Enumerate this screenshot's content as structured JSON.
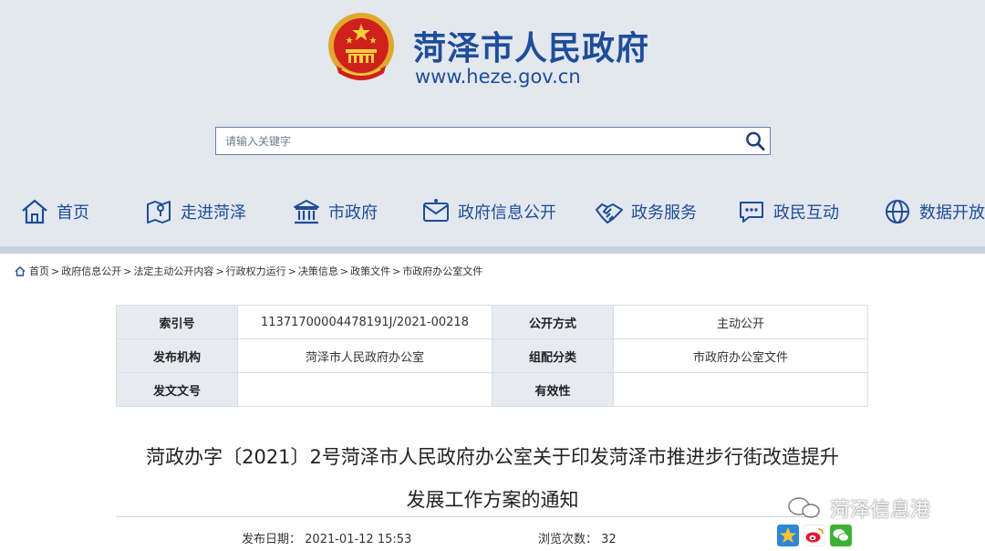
{
  "header": {
    "site_name": "菏泽市人民政府",
    "site_url": "www.heze.gov.cn",
    "accent_color": "#1e4d9a"
  },
  "search": {
    "placeholder": "请输入关键字",
    "icon": "search-icon"
  },
  "nav": {
    "items": [
      {
        "label": "首页",
        "icon": "home-icon"
      },
      {
        "label": "走进菏泽",
        "icon": "map-icon"
      },
      {
        "label": "市政府",
        "icon": "government-building-icon"
      },
      {
        "label": "政府信息公开",
        "icon": "info-mail-icon"
      },
      {
        "label": "政务服务",
        "icon": "handshake-icon"
      },
      {
        "label": "政民互动",
        "icon": "chat-bubble-icon"
      },
      {
        "label": "数据开放",
        "icon": "globe-icon"
      }
    ]
  },
  "breadcrumb": {
    "icon": "home-icon",
    "items": [
      "首页",
      "政府信息公开",
      "法定主动公开内容",
      "行政权力运行",
      "决策信息",
      "政策文件",
      "市政府办公室文件"
    ],
    "separator": ">"
  },
  "meta": {
    "index_label": "索引号",
    "index_value": "11371700004478191J/2021-00218",
    "disclosure_label": "公开方式",
    "disclosure_value": "主动公开",
    "issuer_label": "发布机构",
    "issuer_value": "菏泽市人民政府办公室",
    "category_label": "组配分类",
    "category_value": "市政府办公室文件",
    "docno_label": "发文文号",
    "docno_value": "",
    "validity_label": "有效性",
    "validity_value": ""
  },
  "article": {
    "title_line1": "菏政办字〔2021〕2号菏泽市人民政府办公室关于印发菏泽市推进步行街改造提升",
    "title_line2": "发展工作方案的通知",
    "date_label": "发布日期：",
    "date_value": "2021-01-12 15:53",
    "views_label": "浏览次数：",
    "views_value": "32"
  },
  "watermark": {
    "text": "菏泽信息港"
  },
  "share": {
    "icons": [
      "qzone-star-icon",
      "weibo-icon",
      "wechat-icon"
    ]
  }
}
